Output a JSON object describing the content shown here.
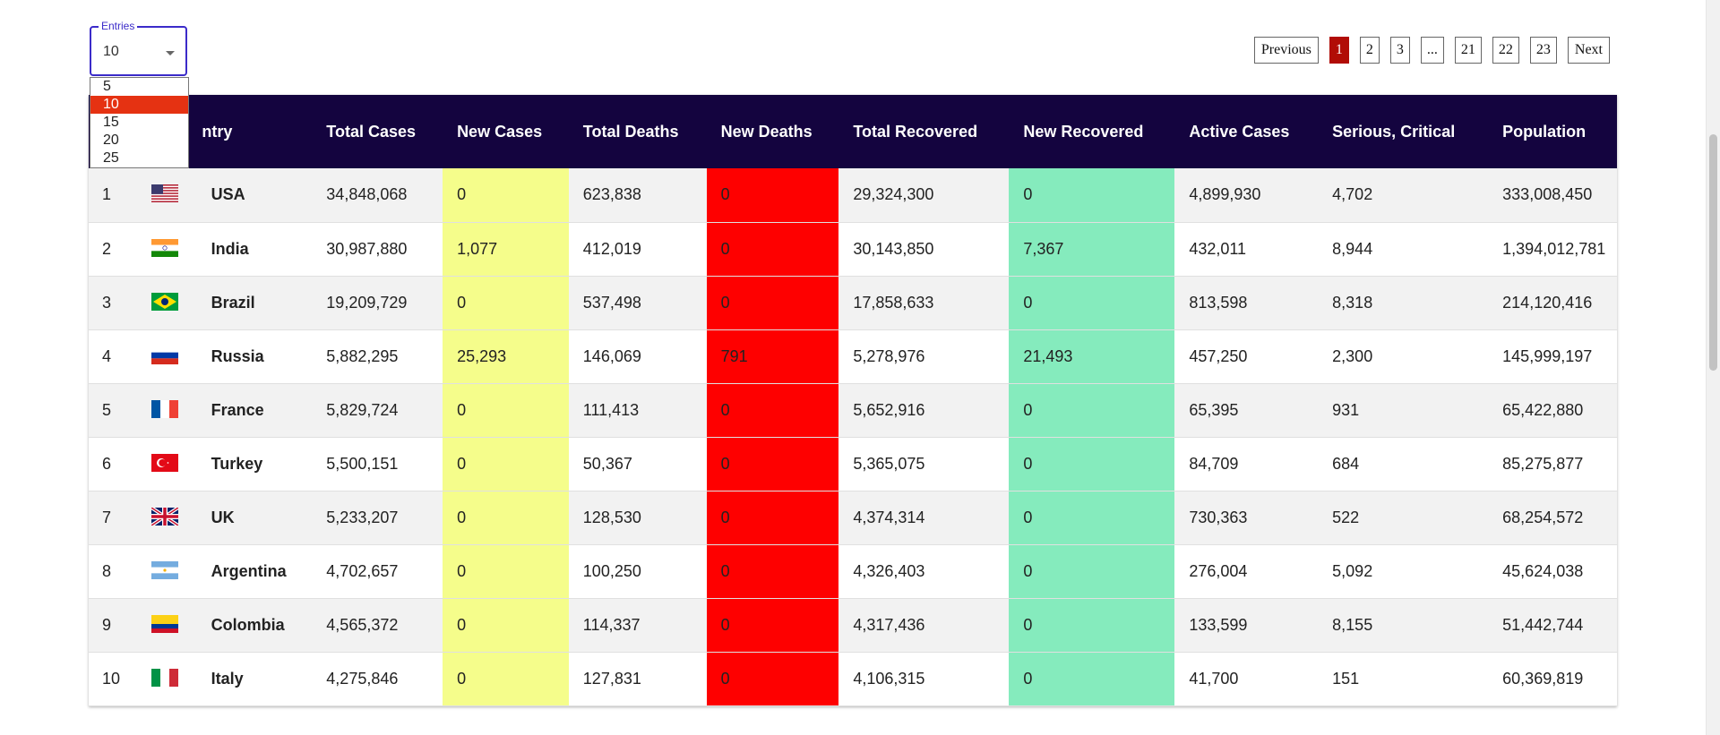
{
  "entries": {
    "legend": "Entries",
    "selected": "10",
    "options": [
      "5",
      "10",
      "15",
      "20",
      "25"
    ]
  },
  "pagination": {
    "previous": "Previous",
    "pages": [
      "1",
      "2",
      "3",
      "...",
      "21",
      "22",
      "23"
    ],
    "active": "1",
    "next": "Next"
  },
  "table": {
    "headers": [
      "",
      "ntry",
      "Total Cases",
      "New Cases",
      "Total Deaths",
      "New Deaths",
      "Total Recovered",
      "New Recovered",
      "Active Cases",
      "Serious, Critical",
      "Population"
    ],
    "rows": [
      {
        "rank": "1",
        "flag": "us-flag-icon",
        "country": "USA",
        "total_cases": "34,848,068",
        "new_cases": "0",
        "total_deaths": "623,838",
        "new_deaths": "0",
        "total_recovered": "29,324,300",
        "new_recovered": "0",
        "active": "4,899,930",
        "serious": "4,702",
        "population": "333,008,450"
      },
      {
        "rank": "2",
        "flag": "india-flag-icon",
        "country": "India",
        "total_cases": "30,987,880",
        "new_cases": "1,077",
        "total_deaths": "412,019",
        "new_deaths": "0",
        "total_recovered": "30,143,850",
        "new_recovered": "7,367",
        "active": "432,011",
        "serious": "8,944",
        "population": "1,394,012,781"
      },
      {
        "rank": "3",
        "flag": "brazil-flag-icon",
        "country": "Brazil",
        "total_cases": "19,209,729",
        "new_cases": "0",
        "total_deaths": "537,498",
        "new_deaths": "0",
        "total_recovered": "17,858,633",
        "new_recovered": "0",
        "active": "813,598",
        "serious": "8,318",
        "population": "214,120,416"
      },
      {
        "rank": "4",
        "flag": "russia-flag-icon",
        "country": "Russia",
        "total_cases": "5,882,295",
        "new_cases": "25,293",
        "total_deaths": "146,069",
        "new_deaths": "791",
        "total_recovered": "5,278,976",
        "new_recovered": "21,493",
        "active": "457,250",
        "serious": "2,300",
        "population": "145,999,197"
      },
      {
        "rank": "5",
        "flag": "france-flag-icon",
        "country": "France",
        "total_cases": "5,829,724",
        "new_cases": "0",
        "total_deaths": "111,413",
        "new_deaths": "0",
        "total_recovered": "5,652,916",
        "new_recovered": "0",
        "active": "65,395",
        "serious": "931",
        "population": "65,422,880"
      },
      {
        "rank": "6",
        "flag": "turkey-flag-icon",
        "country": "Turkey",
        "total_cases": "5,500,151",
        "new_cases": "0",
        "total_deaths": "50,367",
        "new_deaths": "0",
        "total_recovered": "5,365,075",
        "new_recovered": "0",
        "active": "84,709",
        "serious": "684",
        "population": "85,275,877"
      },
      {
        "rank": "7",
        "flag": "uk-flag-icon",
        "country": "UK",
        "total_cases": "5,233,207",
        "new_cases": "0",
        "total_deaths": "128,530",
        "new_deaths": "0",
        "total_recovered": "4,374,314",
        "new_recovered": "0",
        "active": "730,363",
        "serious": "522",
        "population": "68,254,572"
      },
      {
        "rank": "8",
        "flag": "argentina-flag-icon",
        "country": "Argentina",
        "total_cases": "4,702,657",
        "new_cases": "0",
        "total_deaths": "100,250",
        "new_deaths": "0",
        "total_recovered": "4,326,403",
        "new_recovered": "0",
        "active": "276,004",
        "serious": "5,092",
        "population": "45,624,038"
      },
      {
        "rank": "9",
        "flag": "colombia-flag-icon",
        "country": "Colombia",
        "total_cases": "4,565,372",
        "new_cases": "0",
        "total_deaths": "114,337",
        "new_deaths": "0",
        "total_recovered": "4,317,436",
        "new_recovered": "0",
        "active": "133,599",
        "serious": "8,155",
        "population": "51,442,744"
      },
      {
        "rank": "10",
        "flag": "italy-flag-icon",
        "country": "Italy",
        "total_cases": "4,275,846",
        "new_cases": "0",
        "total_deaths": "127,831",
        "new_deaths": "0",
        "total_recovered": "4,106,315",
        "new_recovered": "0",
        "active": "41,700",
        "serious": "151",
        "population": "60,369,819"
      }
    ]
  },
  "colors": {
    "header_bg": "#14043f",
    "new_cases_bg": "#f5fd8b",
    "new_deaths_bg": "#fe0000",
    "new_recovered_bg": "#85ebbd",
    "active_page": "#b10d06",
    "selected_option": "#e53212"
  }
}
